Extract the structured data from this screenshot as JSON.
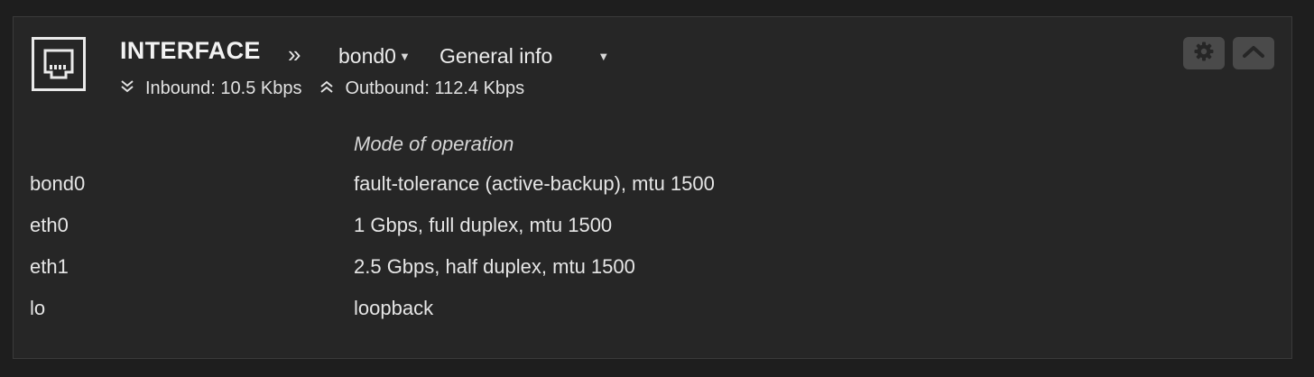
{
  "widget": {
    "title": "INTERFACE",
    "icon": "ethernet-port-icon",
    "breadcrumb_separator": "»"
  },
  "selectors": {
    "interface": {
      "value": "bond0"
    },
    "view": {
      "value": "General info"
    }
  },
  "rates": {
    "inbound": "Inbound: 10.5 Kbps",
    "outbound": "Outbound: 112.4 Kbps"
  },
  "buttons": {
    "settings_icon": "gear-icon",
    "collapse_icon": "chevron-up-icon"
  },
  "table": {
    "column_header": "Mode of operation",
    "rows": [
      {
        "name": "bond0",
        "mode": "fault-tolerance (active-backup), mtu 1500"
      },
      {
        "name": "eth0",
        "mode": "1 Gbps, full duplex, mtu 1500"
      },
      {
        "name": "eth1",
        "mode": "2.5 Gbps, half duplex, mtu 1500"
      },
      {
        "name": "lo",
        "mode": "loopback"
      }
    ]
  },
  "colors": {
    "page_background": "#1e1e1e",
    "panel_background": "#262626",
    "button_background": "#4a4a4a",
    "text": "#e6e6e6"
  }
}
